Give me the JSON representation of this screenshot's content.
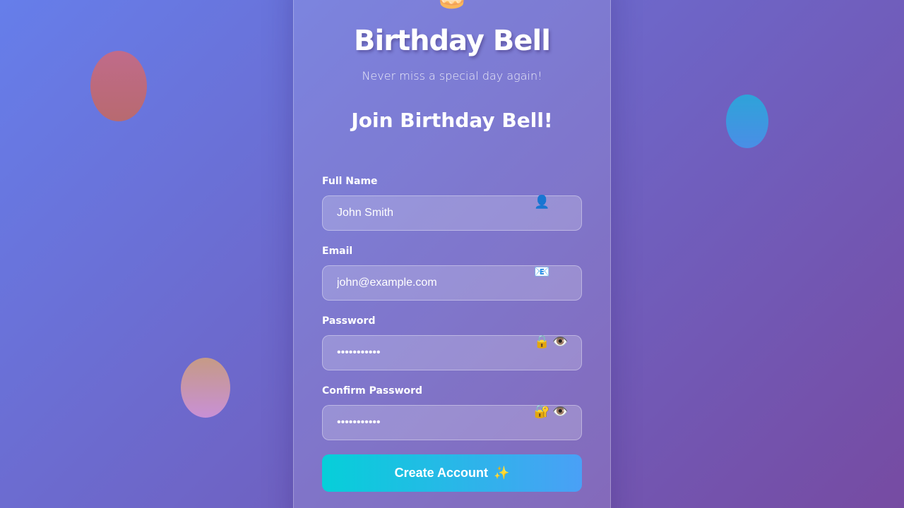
{
  "app": {
    "title": "Birthday Bell",
    "tagline": "Never miss a special day again!",
    "logo_icon": "🎂"
  },
  "form": {
    "title": "Join Birthday Bell!",
    "fields": {
      "full_name": {
        "label": "Full Name",
        "value": "John Smith",
        "icon": "👤"
      },
      "email": {
        "label": "Email",
        "value": "john@example.com",
        "icon": "📧"
      },
      "password": {
        "label": "Password",
        "value": "•••••••••••",
        "icon": "🔒",
        "toggle_icon": "👁️"
      },
      "confirm_password": {
        "label": "Confirm Password",
        "value": "•••••••••••",
        "icon": "🔐",
        "toggle_icon": "👁️"
      }
    },
    "submit": {
      "label": "Create Account",
      "icon": "✨"
    }
  },
  "colors": {
    "background_start": "#667eea",
    "background_end": "#764ba2",
    "button_start": "#06cfd9",
    "button_end": "#4aa0f6"
  }
}
